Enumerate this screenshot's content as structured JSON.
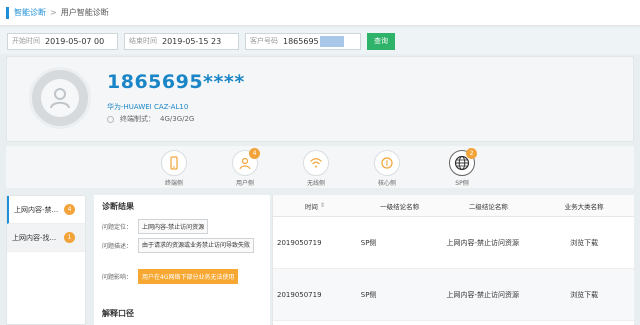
{
  "breadcrumb": {
    "parent": "智能诊断",
    "separator": ">",
    "current": "用户智能诊断"
  },
  "filters": {
    "start_label": "开始时间",
    "start_value": "2019-05-07 00",
    "end_label": "结束时间",
    "end_value": "2019-05-15 23",
    "number_label": "客户号码",
    "number_value": "1865695",
    "query_button": "查询"
  },
  "profile": {
    "msisdn": "1865695****",
    "device": "华为-HUAWEI CAZ-AL10",
    "net_label": "终端制式：",
    "net_value": "4G/3G/2G"
  },
  "dimensions": [
    {
      "label": "终端侧",
      "icon": "terminal-icon",
      "badge": ""
    },
    {
      "label": "用户侧",
      "icon": "user-icon",
      "badge": "4"
    },
    {
      "label": "无线侧",
      "icon": "wifi-icon",
      "badge": ""
    },
    {
      "label": "核心侧",
      "icon": "core-icon",
      "badge": ""
    },
    {
      "label": "SP侧",
      "icon": "globe-icon",
      "badge": "2"
    }
  ],
  "left_list": [
    {
      "label": "上网内容-禁...",
      "count": "4"
    },
    {
      "label": "上网内容-找...",
      "count": "1"
    }
  ],
  "diagnosis": {
    "title": "诊断结果",
    "locate_label": "问题定位：",
    "locate_value": "上网内容-禁止访问资源",
    "desc_label": "问题描述：",
    "desc_value": "由于请求的资源或业务禁止访问导致失败",
    "impact_label": "问题影响：",
    "impact_value": "用户在4G网络下部分业务无法使用",
    "explain_title": "解释口径"
  },
  "table": {
    "headers": [
      "时间",
      "一级结论名称",
      "二级结论名称",
      "业务大类名称"
    ],
    "rows": [
      [
        "2019050719",
        "SP侧",
        "上网内容-禁止访问资源",
        "浏览下载"
      ],
      [
        "2019050719",
        "SP侧",
        "上网内容-禁止访问资源",
        "浏览下载"
      ]
    ]
  },
  "colors": {
    "accent": "#1e8fd6",
    "query_green": "#2fb36a",
    "badge_orange": "#f2a43a"
  }
}
